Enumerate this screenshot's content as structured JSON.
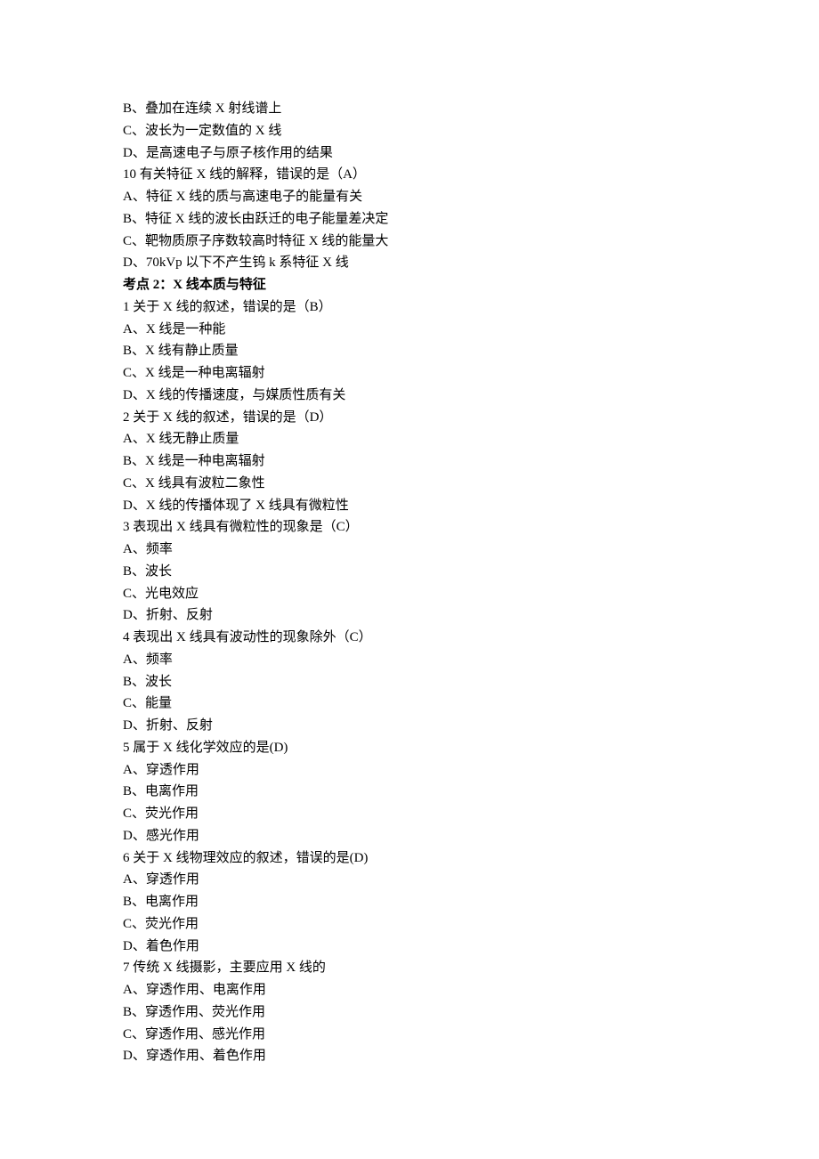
{
  "lines": [
    {
      "text": "B、叠加在连续 X 射线谱上"
    },
    {
      "text": "C、波长为一定数值的 X 线"
    },
    {
      "text": "D、是高速电子与原子核作用的结果"
    },
    {
      "text": "10 有关特征 X 线的解释，错误的是（A）"
    },
    {
      "text": "A、特征 X 线的质与高速电子的能量有关"
    },
    {
      "text": "B、特征 X 线的波长由跃迁的电子能量差决定"
    },
    {
      "text": "C、靶物质原子序数较高时特征 X 线的能量大"
    },
    {
      "text": "D、70kVp 以下不产生钨 k 系特征 X 线"
    },
    {
      "text": "考点 2：X 线本质与特征",
      "heading": true
    },
    {
      "text": "1 关于 X 线的叙述，错误的是（B）"
    },
    {
      "text": "A、X 线是一种能"
    },
    {
      "text": "B、X 线有静止质量"
    },
    {
      "text": "C、X 线是一种电离辐射"
    },
    {
      "text": "D、X 线的传播速度，与媒质性质有关"
    },
    {
      "text": "2 关于 X 线的叙述，错误的是（D）"
    },
    {
      "text": "A、X 线无静止质量"
    },
    {
      "text": "B、X 线是一种电离辐射"
    },
    {
      "text": "C、X 线具有波粒二象性"
    },
    {
      "text": "D、X 线的传播体现了 X 线具有微粒性"
    },
    {
      "text": "3 表现出 X 线具有微粒性的现象是（C）"
    },
    {
      "text": "A、频率"
    },
    {
      "text": "B、波长"
    },
    {
      "text": "C、光电效应"
    },
    {
      "text": "D、折射、反射"
    },
    {
      "text": "4 表现出 X 线具有波动性的现象除外（C）"
    },
    {
      "text": "A、频率"
    },
    {
      "text": "B、波长"
    },
    {
      "text": "C、能量"
    },
    {
      "text": "D、折射、反射"
    },
    {
      "text": "5 属于 X 线化学效应的是(D)"
    },
    {
      "text": "A、穿透作用"
    },
    {
      "text": "B、电离作用"
    },
    {
      "text": "C、荧光作用"
    },
    {
      "text": "D、感光作用"
    },
    {
      "text": "6 关于 X 线物理效应的叙述，错误的是(D)"
    },
    {
      "text": "A、穿透作用"
    },
    {
      "text": "B、电离作用"
    },
    {
      "text": "C、荧光作用"
    },
    {
      "text": "D、着色作用"
    },
    {
      "text": "7 传统 X 线摄影，主要应用 X 线的"
    },
    {
      "text": "A、穿透作用、电离作用"
    },
    {
      "text": "B、穿透作用、荧光作用"
    },
    {
      "text": "C、穿透作用、感光作用"
    },
    {
      "text": "D、穿透作用、着色作用"
    }
  ]
}
